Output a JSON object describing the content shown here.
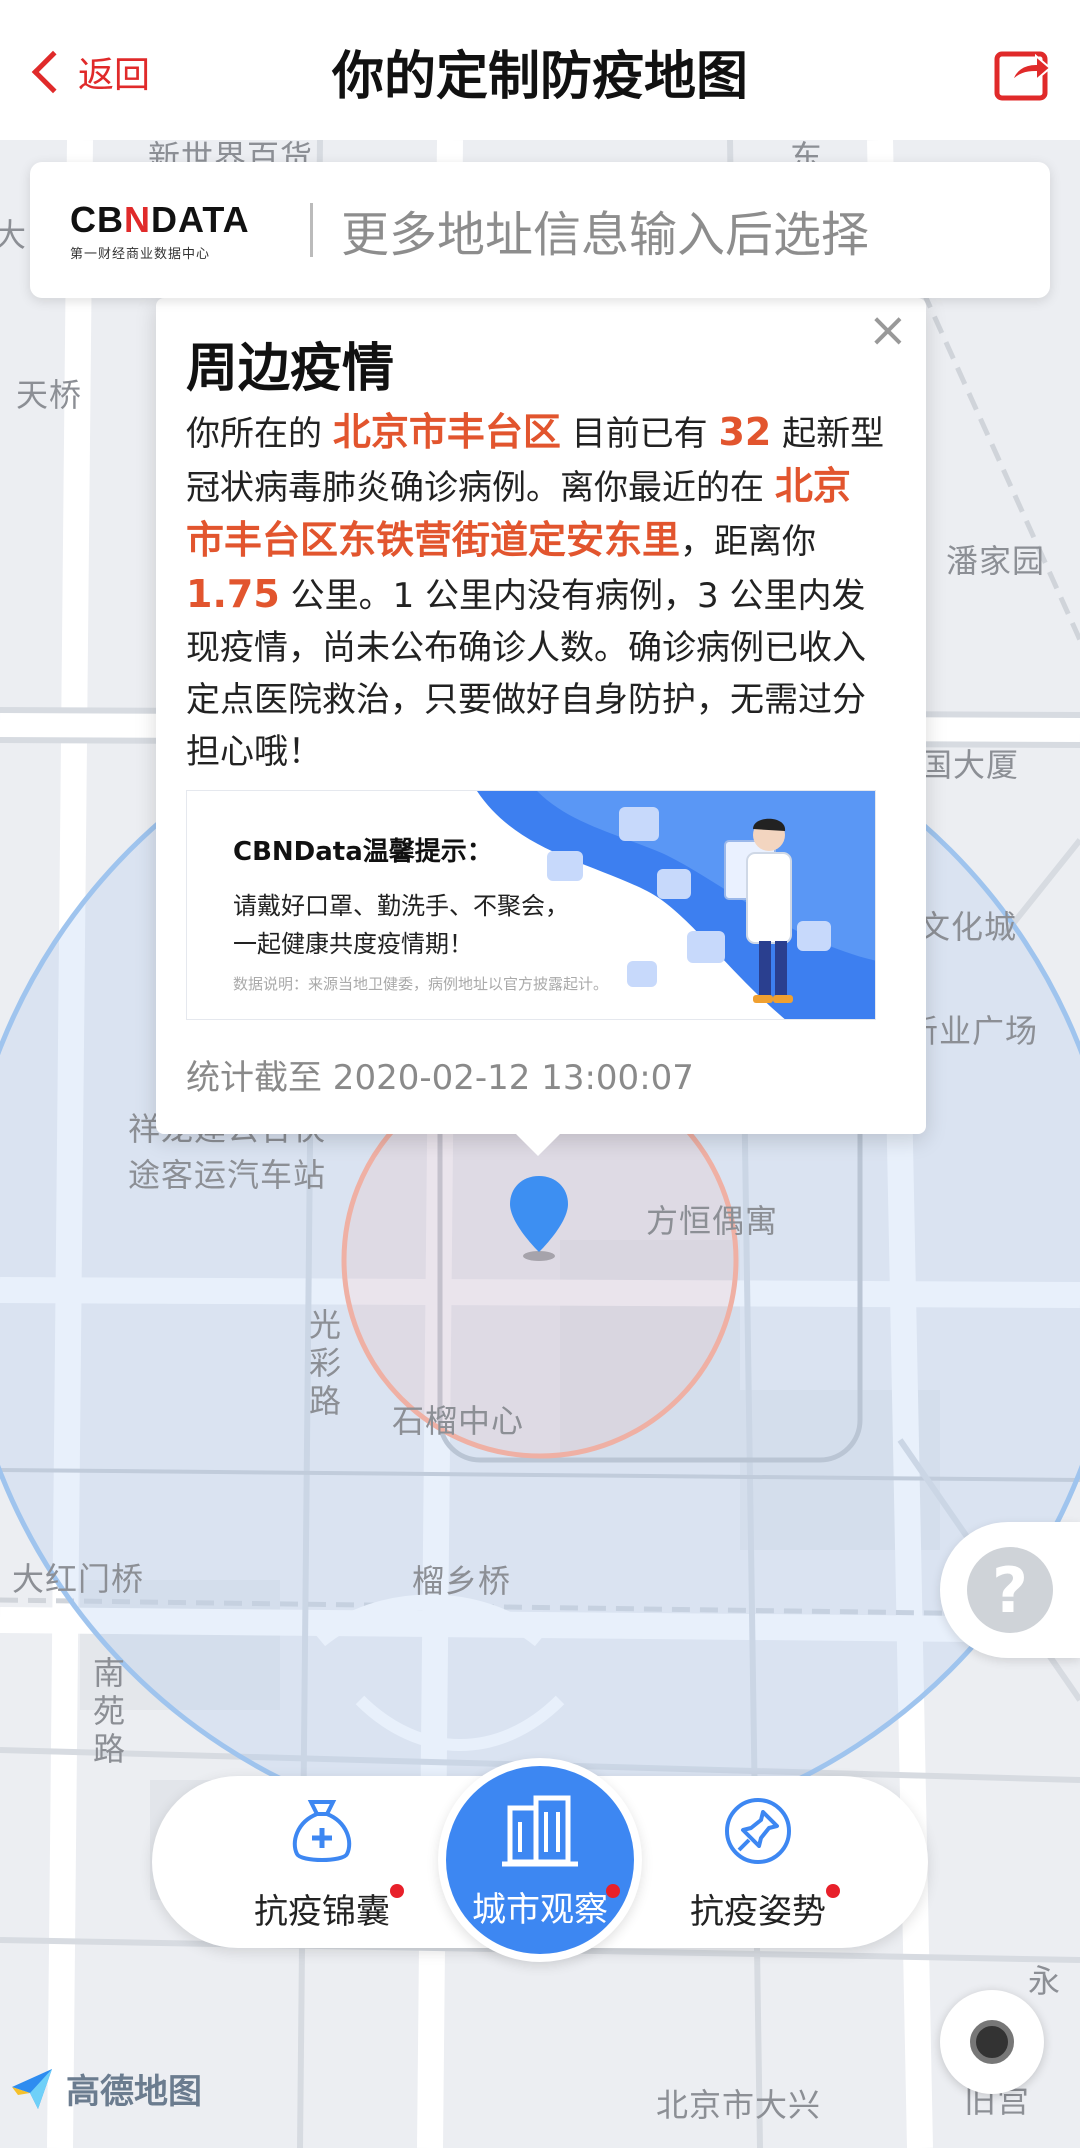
{
  "nav": {
    "back_label": "返回",
    "title": "你的定制防疫地图"
  },
  "search": {
    "brand_prefix": "CB",
    "brand_mid": "N",
    "brand_suffix": "DATA",
    "brand_sub": "第一财经商业数据中心",
    "placeholder": "更多地址信息输入后选择"
  },
  "map_labels": {
    "l1": "新世界百货",
    "l2": "东",
    "l3": "天桥",
    "l4": "潘家园",
    "l5": "国大厦",
    "l6": "文化城",
    "l7": "新业广场",
    "l8": "祥龙建公合伙",
    "l9": "途客运汽车站",
    "l10": "方恒偶寓",
    "l11": "光彩路",
    "l12": "石榴中心",
    "l13": "大红门桥",
    "l14": "榴乡桥",
    "l15": "南苑路",
    "l16": "永",
    "l17": "北京市大兴",
    "l18": "旧宫",
    "l19": "大"
  },
  "popup": {
    "title": "周边疫情",
    "t1": "你所在的",
    "district": "北京市丰台区",
    "t2": "目前已有",
    "count": "32",
    "t3": "起新型冠状病毒肺炎确诊病例。离你最近的在",
    "nearest": "北京市丰台区东铁营街道定安东里",
    "t4": "，距离你",
    "distance": "1.75",
    "t5": "公里。1 公里内没有病例，3 公里内发现疫情，尚未公布确诊人数。确诊病例已收入定点医院救治，只要做好自身防护，无需过分担心哦！",
    "tips_title": "CBNData温馨提示：",
    "tips_line1": "请戴好口罩、勤洗手、不聚会，",
    "tips_line2": "一起健康共度疫情期！",
    "tips_note": "数据说明：来源当地卫健委，病例地址以官方披露起计。",
    "stamp": "统计截至 2020-02-12 13:00:07"
  },
  "toolbar": {
    "left_label": "抗疫锦囊",
    "center_label": "城市观察",
    "right_label": "抗疫姿势"
  },
  "help_label": "?",
  "amap_label": "高德地图",
  "colors": {
    "accent_red": "#e02a2a",
    "highlight_orange": "#e2552e",
    "primary_blue": "#3d87f2",
    "badge_red": "#e8202a"
  }
}
